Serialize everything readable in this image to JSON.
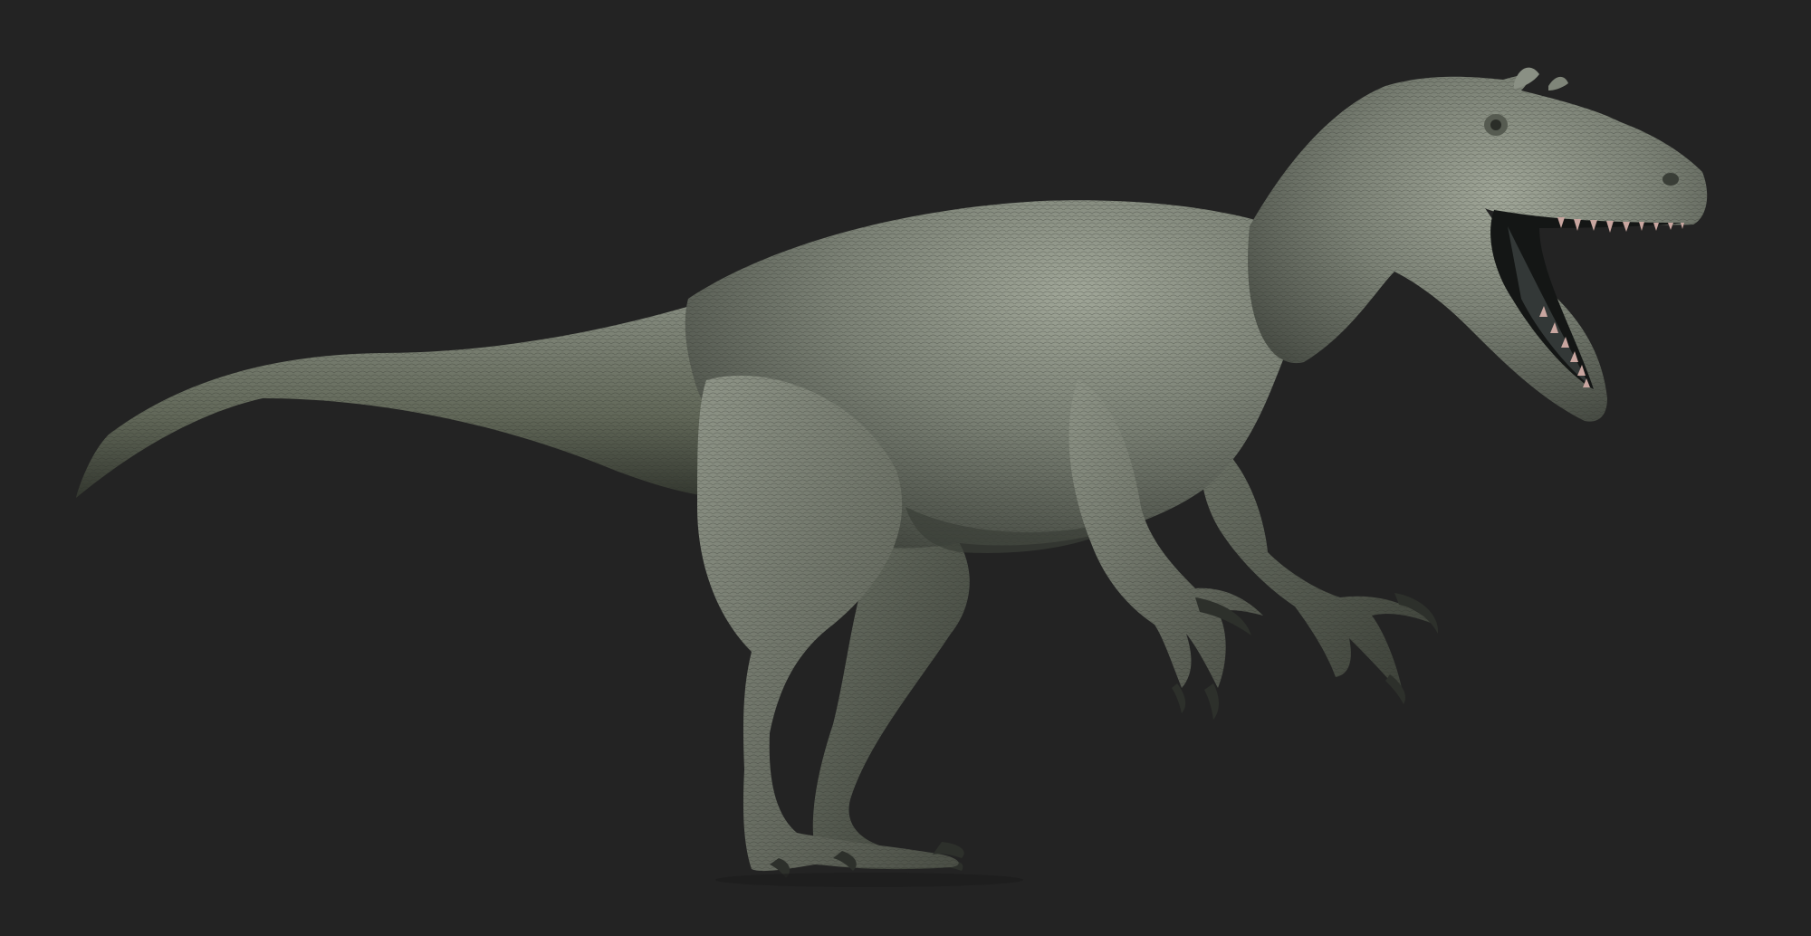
{
  "scene": {
    "background_color": "#232323",
    "subject": "dinosaur-sculpt",
    "skin_color": "#7c8276",
    "shadow_color": "#3a3e37",
    "highlight_color": "#a4aa9c",
    "claw_color": "#2d302b",
    "teeth_color": "#c9a6a0",
    "mouth_color": "#141615"
  }
}
